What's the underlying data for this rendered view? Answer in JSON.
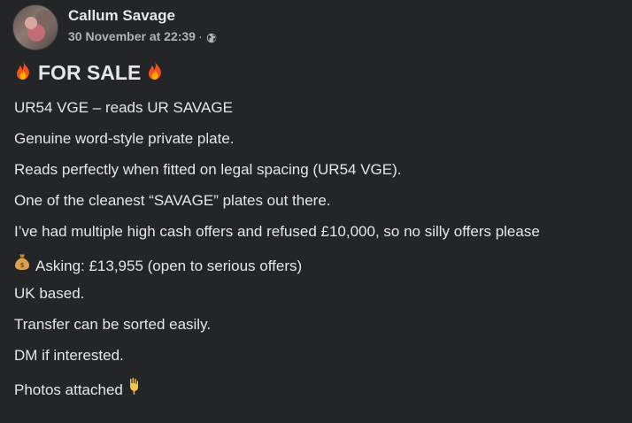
{
  "post": {
    "author": "Callum Savage",
    "timestamp": "30 November at 22:39",
    "separator": "·",
    "audience_icon": "globe-icon",
    "title": "FOR SALE",
    "title_icon": "fire-icon",
    "lines": [
      "UR54 VGE – reads UR SAVAGE",
      "Genuine word-style private plate.",
      "Reads perfectly when fitted on legal spacing (UR54 VGE).",
      "One of the cleanest “SAVAGE” plates out there.",
      "I’ve had multiple high cash offers and refused £10,000, so no silly offers please",
      "Asking: £13,955 (open to serious offers)",
      "UK based.",
      "Transfer can be sorted easily.",
      "DM if interested.",
      "Photos attached"
    ],
    "asking_icon": "money-bag-icon",
    "photos_icon": "pointing-down-icon"
  },
  "colors": {
    "background": "#242526",
    "text_primary": "#e4e6eb",
    "text_secondary": "#b0b3b8"
  }
}
